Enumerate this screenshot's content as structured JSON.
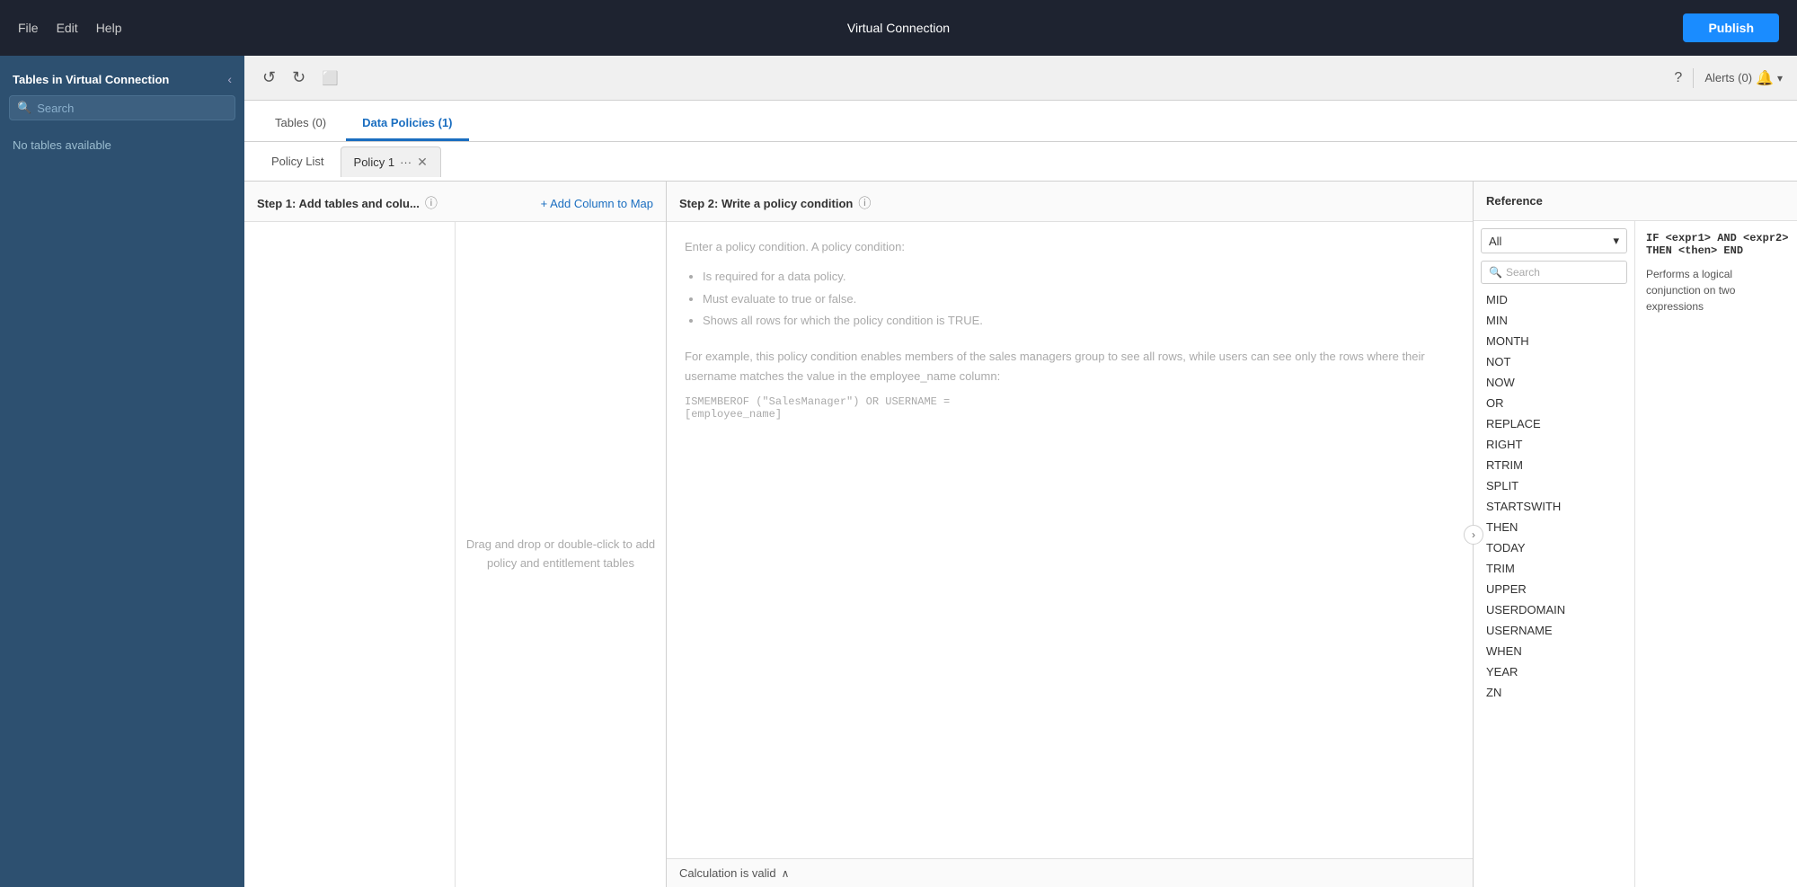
{
  "topbar": {
    "title": "Virtual Connection",
    "menu": [
      "File",
      "Edit",
      "Help"
    ],
    "publish_label": "Publish",
    "alerts_label": "Alerts (0)"
  },
  "sidebar": {
    "title": "Tables in Virtual Connection",
    "search_placeholder": "Search",
    "empty_message": "No tables available",
    "collapse_icon": "‹"
  },
  "toolbar": {
    "undo_icon": "↺",
    "redo_icon": "↻",
    "save_icon": "☐"
  },
  "tabs": [
    {
      "label": "Tables (0)",
      "active": false
    },
    {
      "label": "Data Policies (1)",
      "active": true
    }
  ],
  "policy_tabs": {
    "list_label": "Policy List",
    "active_tab_label": "Policy 1",
    "more_icon": "···",
    "close_icon": "✕"
  },
  "step1": {
    "title": "Step 1: Add tables and colu...",
    "info_icon": "ⓘ",
    "add_column_label": "+ Add Column to Map",
    "drag_drop_text": "Drag and drop or double-click to add\npolicy and entitlement tables"
  },
  "step2": {
    "title": "Step 2: Write a policy condition",
    "info_icon": "ⓘ",
    "placeholder_title": "Enter a policy condition. A policy condition:",
    "bullets": [
      "Is required for a data policy.",
      "Must evaluate to true or false.",
      "Shows all rows for which the policy condition is TRUE."
    ],
    "example_text": "For example, this policy condition enables members of the sales managers group to see all rows, while users can see only the rows where their username matches the value in the employee_name column:",
    "code": "ISMEMBEROF (\"SalesManager\") OR USERNAME =\n[employee_name]",
    "calc_valid_label": "Calculation is valid",
    "chevron_up": "∧"
  },
  "reference": {
    "title": "Reference",
    "dropdown_value": "All",
    "dropdown_arrow": "▾",
    "search_placeholder": "Search",
    "items": [
      "MID",
      "MIN",
      "MONTH",
      "NOT",
      "NOW",
      "OR",
      "REPLACE",
      "RIGHT",
      "RTRIM",
      "SPLIT",
      "STARTSWITH",
      "THEN",
      "TODAY",
      "TRIM",
      "UPPER",
      "USERDOMAIN",
      "USERNAME",
      "WHEN",
      "YEAR",
      "ZN"
    ],
    "detail_code": "IF <expr1> AND <expr2>\nTHEN <then> END",
    "detail_desc": "Performs a logical conjunction on two expressions"
  }
}
